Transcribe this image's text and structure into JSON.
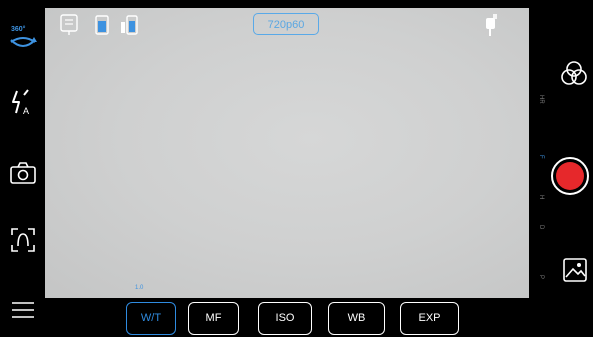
{
  "resolution_badge": "720p60",
  "left_toolbar": {
    "rotate_label": "360°"
  },
  "mode_strip": [
    "HR",
    "F",
    "H",
    "D",
    "P"
  ],
  "zoom_indicator": "1.0",
  "bottom_tabs": [
    {
      "label": "W/T",
      "active": true
    },
    {
      "label": "MF",
      "active": false
    },
    {
      "label": "ISO",
      "active": false
    },
    {
      "label": "WB",
      "active": false
    },
    {
      "label": "EXP",
      "active": false
    }
  ],
  "colors": {
    "accent": "#2f8be0",
    "record": "#e6282b",
    "icon": "#ffffff"
  }
}
